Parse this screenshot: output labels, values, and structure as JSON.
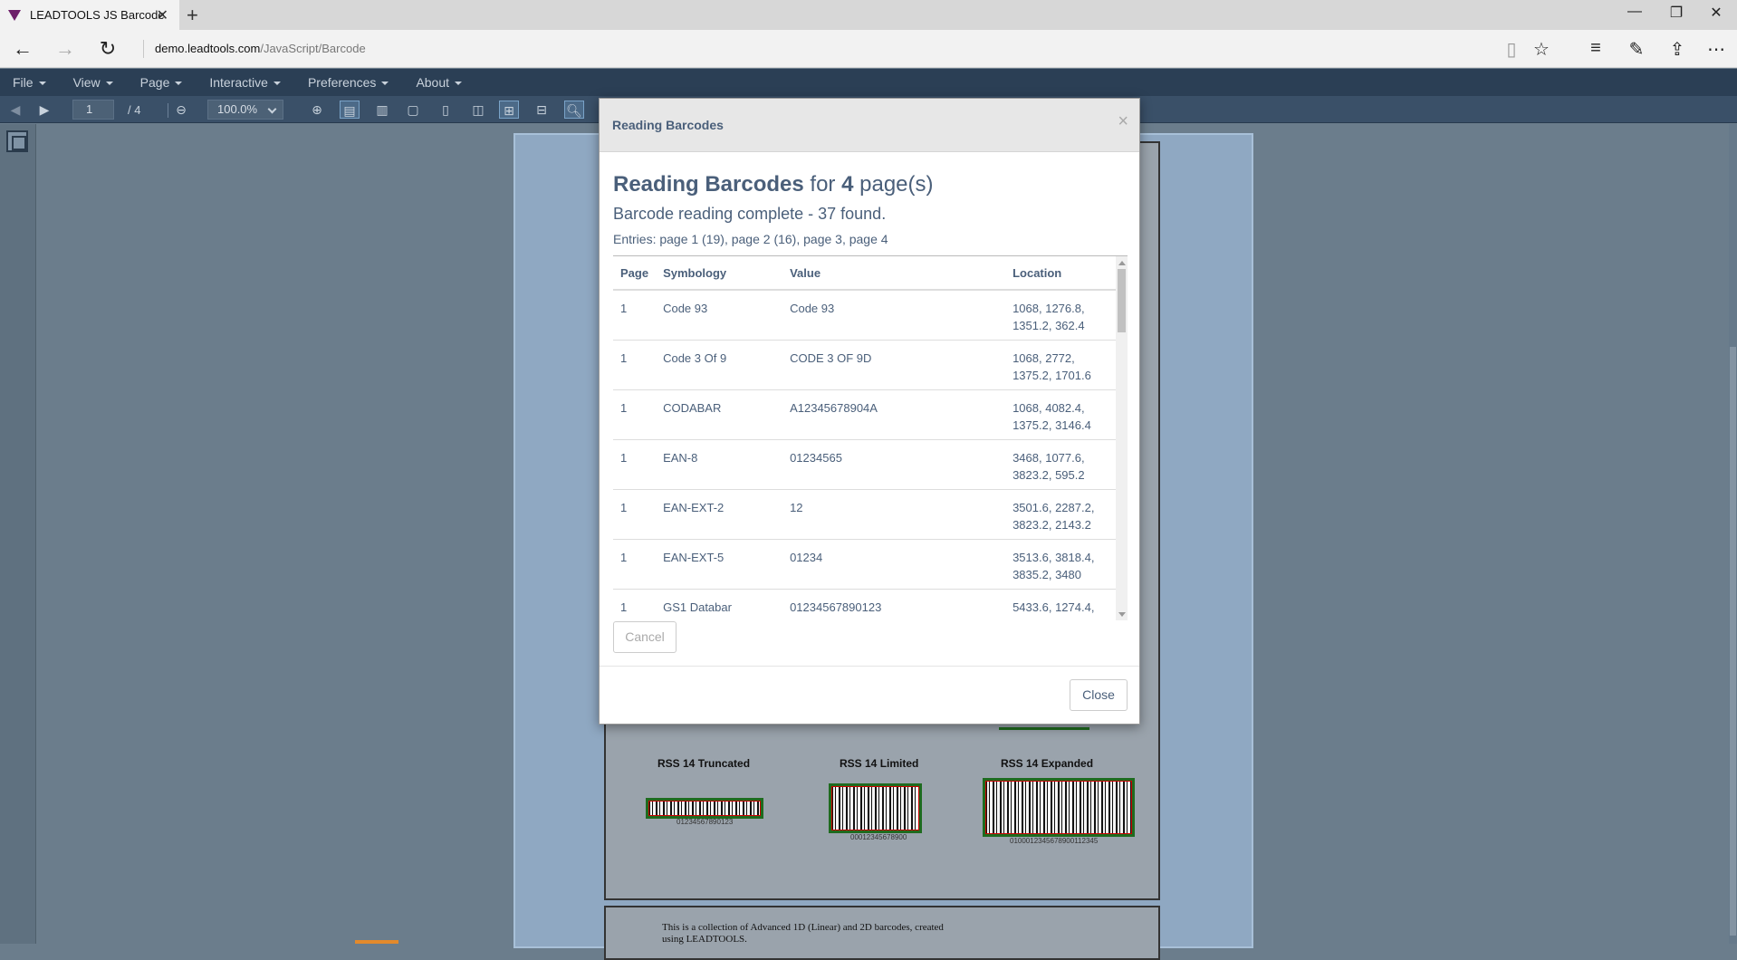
{
  "browser": {
    "tab_title": "LEADTOOLS JS Barcode",
    "url_host": "demo.leadtools.com",
    "url_path": "/JavaScript/Barcode"
  },
  "menubar": {
    "items": [
      "File",
      "View",
      "Page",
      "Interactive",
      "Preferences",
      "About"
    ]
  },
  "toolbar": {
    "page_value": "1",
    "page_total": "/ 4",
    "zoom_value": "100.0%"
  },
  "document": {
    "labels": [
      "RSS 14 Truncated",
      "RSS 14 Limited",
      "RSS 14 Expanded"
    ],
    "captions": [
      "01234567890123",
      "00012345678900",
      "0100012345678900112345"
    ],
    "page2_text": "This is a collection of Advanced 1D (Linear) and 2D barcodes, created using LEADTOOLS."
  },
  "modal": {
    "header_title": "Reading Barcodes",
    "close_x": "×",
    "heading_bold": "Reading Barcodes",
    "heading_for": "for",
    "heading_count": "4",
    "heading_suffix": "page(s)",
    "status": "Barcode reading complete - 37 found.",
    "entries": "Entries: page 1 (19), page 2 (16), page 3, page 4",
    "columns": [
      "Page",
      "Symbology",
      "Value",
      "Location"
    ],
    "rows": [
      {
        "page": "1",
        "symbology": "Code 93",
        "value": "Code 93",
        "loc1": "1068, 1276.8,",
        "loc2": "1351.2, 362.4"
      },
      {
        "page": "1",
        "symbology": "Code 3 Of 9",
        "value": "CODE 3 OF 9D",
        "loc1": "1068, 2772,",
        "loc2": "1375.2, 1701.6"
      },
      {
        "page": "1",
        "symbology": "CODABAR",
        "value": "A12345678904A",
        "loc1": "1068, 4082.4,",
        "loc2": "1375.2, 3146.4"
      },
      {
        "page": "1",
        "symbology": "EAN-8",
        "value": "01234565",
        "loc1": "3468, 1077.6,",
        "loc2": "3823.2, 595.2"
      },
      {
        "page": "1",
        "symbology": "EAN-EXT-2",
        "value": "12",
        "loc1": "3501.6, 2287.2,",
        "loc2": "3823.2, 2143.2"
      },
      {
        "page": "1",
        "symbology": "EAN-EXT-5",
        "value": "01234",
        "loc1": "3513.6, 3818.4,",
        "loc2": "3835.2, 3480"
      },
      {
        "page": "1",
        "symbology": "GS1 Databar",
        "value": "01234567890123",
        "loc1": "5433.6, 1274.4,",
        "loc2": ""
      }
    ],
    "cancel_label": "Cancel",
    "close_label": "Close"
  }
}
